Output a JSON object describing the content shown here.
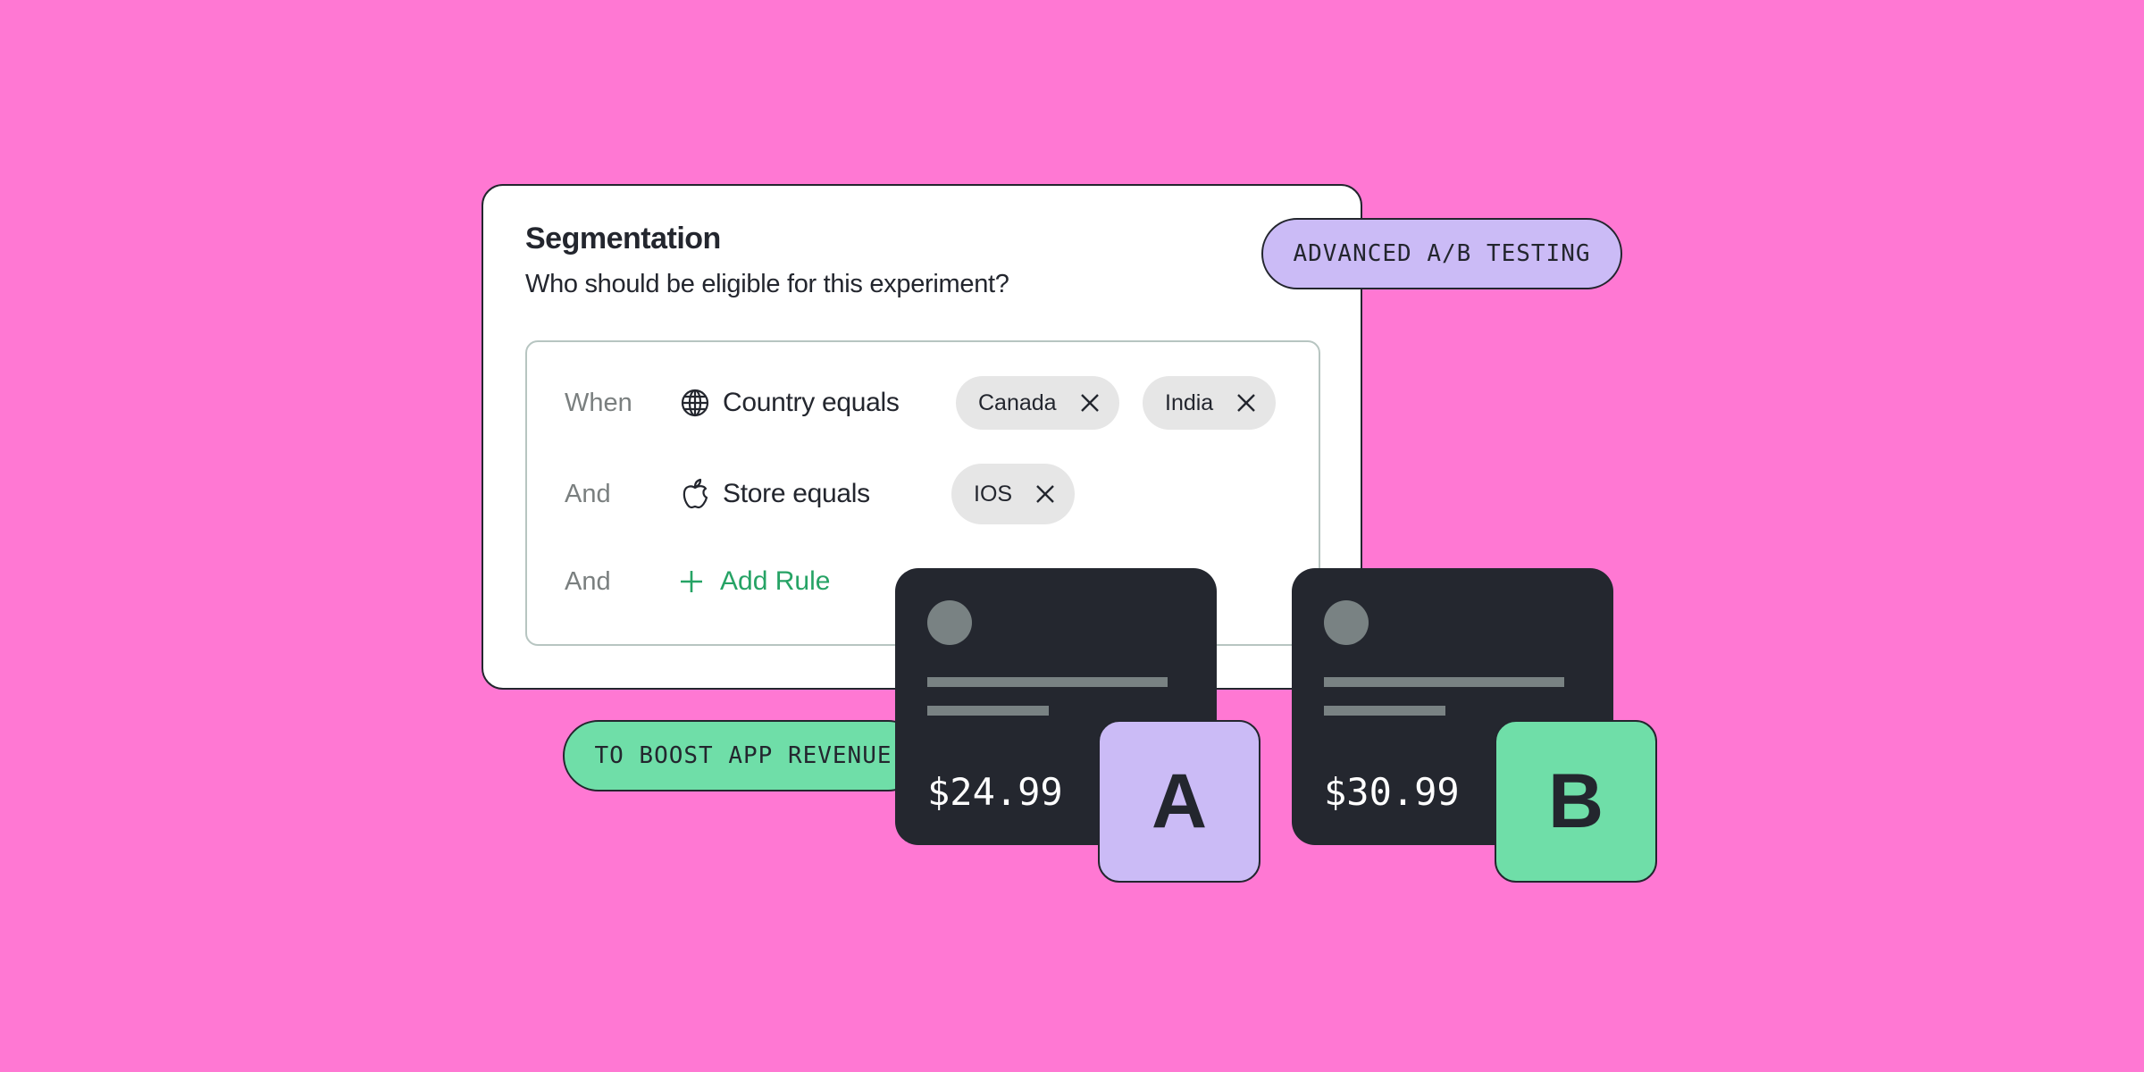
{
  "segmentation": {
    "title": "Segmentation",
    "subtitle": "Who should be eligible for this experiment?",
    "rules": [
      {
        "conjunction": "When",
        "icon": "globe-icon",
        "label": "Country equals",
        "values": [
          "Canada",
          "India"
        ]
      },
      {
        "conjunction": "And",
        "icon": "apple-icon",
        "label": "Store equals",
        "values": [
          "IOS"
        ]
      }
    ],
    "add_rule": {
      "conjunction": "And",
      "icon": "plus-icon",
      "label": "Add Rule"
    }
  },
  "badges": {
    "advanced": "ADVANCED A/B TESTING",
    "boost": "TO BOOST APP REVENUE"
  },
  "variants": [
    {
      "label": "A",
      "price": "$24.99",
      "color": "#cbbbf6"
    },
    {
      "label": "B",
      "price": "$30.99",
      "color": "#6fdea8"
    }
  ],
  "colors": {
    "background": "#ff78d3",
    "card_dark": "#24272f",
    "accent_green": "#26a365",
    "lavender": "#cbbbf6",
    "mint": "#6fdea8",
    "chip_bg": "#e6e6e6"
  }
}
